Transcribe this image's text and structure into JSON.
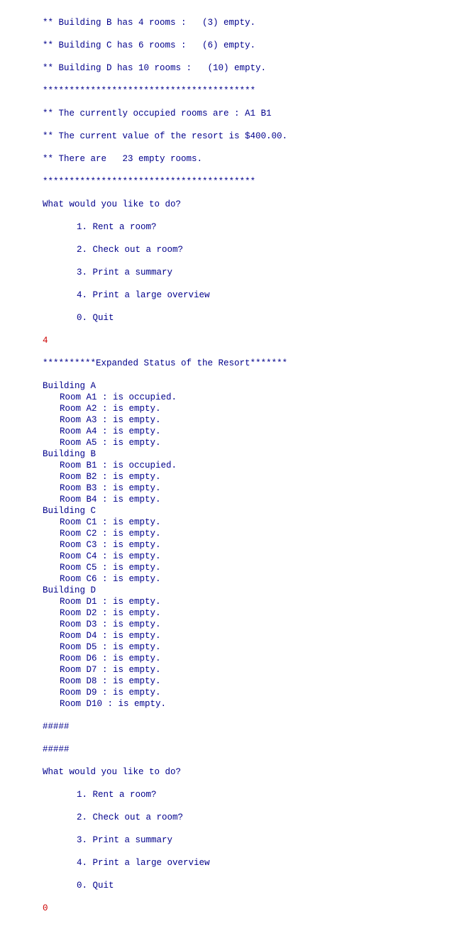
{
  "summary_head": {
    "b": "** Building B has 4 rooms :   (3) empty.",
    "c": "** Building C has 6 rooms :   (6) empty.",
    "d": "** Building D has 10 rooms :   (10) empty.",
    "sep": "****************************************",
    "occupied": "** The currently occupied rooms are : A1 B1",
    "value": "** The current value of the resort is $400.00.",
    "empty": "** There are   23 empty rooms.",
    "sep2": "****************************************"
  },
  "menu": {
    "prompt": "What would you like to do?",
    "opt1": "1. Rent a room?",
    "opt2": "2. Check out a room?",
    "opt3": "3. Print a summary",
    "opt4": "4. Print a large overview",
    "opt0": "0. Quit"
  },
  "input1": "4",
  "expanded": {
    "header": "**********Expanded Status of the Resort*******",
    "buildings": [
      {
        "name": "Building A",
        "rooms": [
          {
            "text": "Room A1 : is occupied."
          },
          {
            "text": "Room A2 : is empty."
          },
          {
            "text": "Room A3 : is empty."
          },
          {
            "text": "Room A4 : is empty."
          },
          {
            "text": "Room A5 : is empty."
          }
        ]
      },
      {
        "name": "Building B",
        "rooms": [
          {
            "text": "Room B1 : is occupied."
          },
          {
            "text": "Room B2 : is empty."
          },
          {
            "text": "Room B3 : is empty."
          },
          {
            "text": "Room B4 : is empty."
          }
        ]
      },
      {
        "name": "Building C",
        "rooms": [
          {
            "text": "Room C1 : is empty."
          },
          {
            "text": "Room C2 : is empty."
          },
          {
            "text": "Room C3 : is empty."
          },
          {
            "text": "Room C4 : is empty."
          },
          {
            "text": "Room C5 : is empty."
          },
          {
            "text": "Room C6 : is empty."
          }
        ]
      },
      {
        "name": "Building D",
        "rooms": [
          {
            "text": "Room D1 : is empty."
          },
          {
            "text": "Room D2 : is empty."
          },
          {
            "text": "Room D3 : is empty."
          },
          {
            "text": "Room D4 : is empty."
          },
          {
            "text": "Room D5 : is empty."
          },
          {
            "text": "Room D6 : is empty."
          },
          {
            "text": "Room D7 : is empty."
          },
          {
            "text": "Room D8 : is empty."
          },
          {
            "text": "Room D9 : is empty."
          },
          {
            "text": "Room D10 : is empty."
          }
        ]
      }
    ]
  },
  "hashes": "#####",
  "input2": "0"
}
